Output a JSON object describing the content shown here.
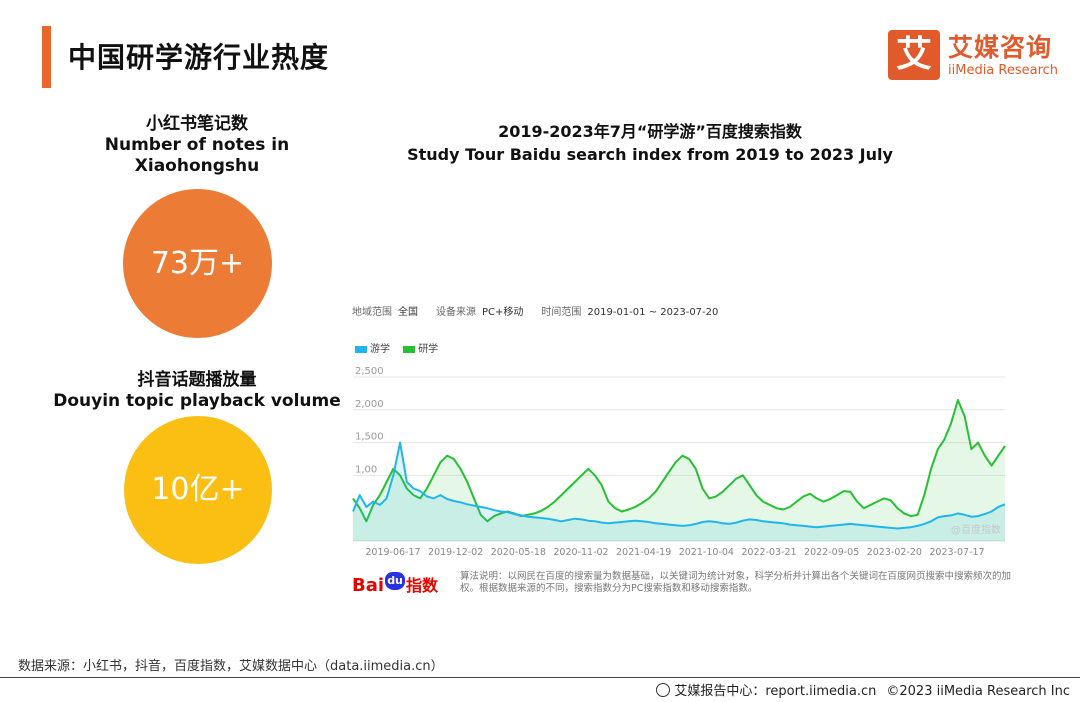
{
  "page": {
    "title": "中国研学游行业热度",
    "source": "数据来源：小红书，抖音，百度指数，艾媒数据中心（data.iimedia.cn）"
  },
  "logo": {
    "mark": "艾",
    "name_cn": "艾媒咨询",
    "name_en": "iiMedia Research",
    "color": "#e05a2b"
  },
  "stats": [
    {
      "label_cn": "小红书笔记数",
      "label_en_1": "Number of notes in",
      "label_en_2": "Xiaohongshu",
      "value": "73万+",
      "color": "#ec7b36"
    },
    {
      "label_cn": "抖音话题播放量",
      "label_en_1": "Douyin topic playback volume",
      "value": "10亿+",
      "color": "#fbbe12"
    }
  ],
  "chart_title": {
    "cn": "2019-2023年7月“研学游”百度搜索指数",
    "en": "Study Tour Baidu search index from 2019 to 2023 July"
  },
  "filters": {
    "region_label": "地域范围",
    "region_value": "全国",
    "device_label": "设备来源",
    "device_value": "PC+移动",
    "time_label": "时间范围",
    "time_value": "2019-01-01 ~ 2023-07-20"
  },
  "chart_data": {
    "type": "area",
    "title": "2019-2023年7月“研学游”百度搜索指数",
    "xlabel": "",
    "ylabel": "",
    "ylim": [
      0,
      2500
    ],
    "yticks": [
      2500,
      2000,
      1500,
      1000
    ],
    "ytick_labels": [
      "2,500",
      "2,000",
      "1,500",
      "1,00"
    ],
    "xtick_labels": [
      "2019-06-17",
      "2019-12-02",
      "2020-05-18",
      "2020-11-02",
      "2021-04-19",
      "2021-10-04",
      "2022-03-21",
      "2022-09-05",
      "2023-02-20",
      "2023-07-17"
    ],
    "grid": true,
    "legend_position": "top-left",
    "watermark": "@百度指数",
    "series": [
      {
        "name": "游学",
        "color": "#1fb6ec",
        "values": [
          450,
          700,
          520,
          600,
          550,
          650,
          1000,
          1500,
          900,
          800,
          760,
          680,
          650,
          700,
          640,
          610,
          590,
          560,
          540,
          520,
          500,
          470,
          450,
          440,
          410,
          390,
          370,
          360,
          350,
          340,
          320,
          300,
          320,
          340,
          330,
          310,
          300,
          280,
          270,
          280,
          290,
          300,
          310,
          300,
          290,
          270,
          260,
          250,
          240,
          230,
          240,
          260,
          290,
          300,
          290,
          270,
          260,
          280,
          310,
          330,
          320,
          300,
          290,
          280,
          270,
          250,
          240,
          230,
          220,
          210,
          220,
          230,
          240,
          250,
          260,
          250,
          240,
          230,
          220,
          210,
          200,
          190,
          200,
          210,
          230,
          260,
          300,
          360,
          380,
          390,
          420,
          400,
          370,
          380,
          410,
          450,
          520,
          560
        ]
      },
      {
        "name": "研学",
        "color": "#26c033",
        "values": [
          650,
          500,
          300,
          550,
          700,
          900,
          1100,
          1000,
          800,
          700,
          650,
          800,
          1000,
          1200,
          1300,
          1250,
          1100,
          900,
          650,
          400,
          300,
          380,
          420,
          450,
          420,
          380,
          400,
          420,
          460,
          520,
          600,
          700,
          800,
          900,
          1000,
          1100,
          1000,
          850,
          600,
          500,
          450,
          480,
          520,
          580,
          650,
          750,
          900,
          1050,
          1200,
          1300,
          1250,
          1100,
          800,
          650,
          680,
          750,
          850,
          950,
          1000,
          850,
          700,
          600,
          550,
          500,
          480,
          520,
          600,
          680,
          720,
          650,
          600,
          640,
          700,
          760,
          750,
          600,
          500,
          550,
          600,
          650,
          620,
          500,
          420,
          380,
          400,
          700,
          1100,
          1400,
          1550,
          1800,
          2150,
          1900,
          1400,
          1500,
          1300,
          1150,
          1300,
          1450
        ]
      }
    ]
  },
  "baidu": {
    "text1": "Bai",
    "paw": "du",
    "text2": "指数"
  },
  "algo_note": "算法说明：以网民在百度的搜索量为数据基础，以关键词为统计对象，科学分析并计算出各个关键词在百度网页搜索中搜索频次的加权。根据数据来源的不同，搜索指数分为PC搜索指数和移动搜索指数。",
  "footer": {
    "center": "艾媒报告中心：report.iimedia.cn",
    "copyright": "©2023  iiMedia Research  Inc"
  }
}
